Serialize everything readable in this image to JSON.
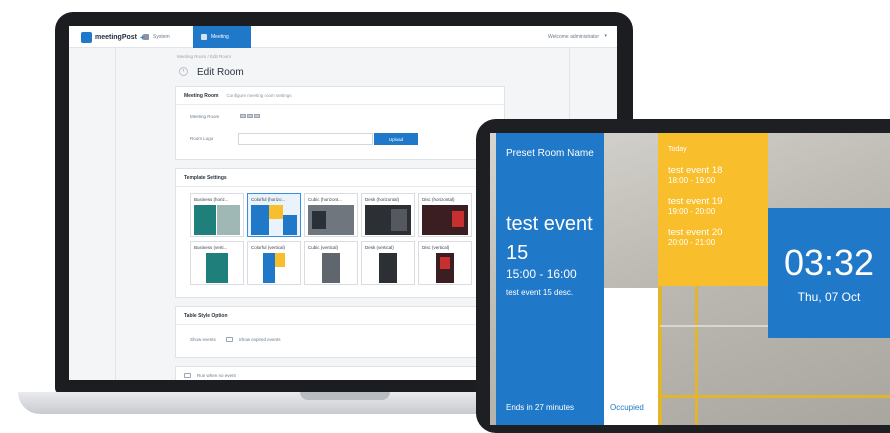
{
  "admin": {
    "app_name": "meetingPost",
    "app_plus": "+",
    "nav": [
      {
        "label": "System"
      },
      {
        "label": "Meeting"
      }
    ],
    "welcome": "Welcome administrator",
    "breadcrumb": "Meeting Room / Edit Room",
    "page_title": "Edit Room",
    "meeting_room_card": {
      "title": "Meeting Room",
      "subtitle": "Configure meeting room settings",
      "meeting_room_label": "Meeting Room",
      "room_logo_label": "Room Logo",
      "upload_label": "Upload"
    },
    "template_card": {
      "title": "Template Settings",
      "templates": [
        {
          "label": "Business (horiz..."
        },
        {
          "label": "Colorful (horizo..."
        },
        {
          "label": "Cubic (horizont..."
        },
        {
          "label": "Desk (horizontal)"
        },
        {
          "label": "Disc (horizontal)"
        },
        {
          "label": "Business (verti..."
        },
        {
          "label": "Colorful (vertical)"
        },
        {
          "label": "Cubic (vertical)"
        },
        {
          "label": "Desk (vertical)"
        },
        {
          "label": "Disc (vertical)"
        }
      ]
    },
    "table_card": {
      "title": "Table Style Option",
      "show_events_label": "Show events",
      "show_expired_label": "Show expired events"
    },
    "bottom_option": "Run when no event"
  },
  "display": {
    "room_name": "Preset Room Name",
    "current_event": "test event 15",
    "current_time": "15:00 - 16:00",
    "current_desc": "test event 15 desc.",
    "ends_in": "Ends in 27 minutes",
    "status": "Occupied",
    "today_label": "Today",
    "upcoming": [
      {
        "name": "test event 18",
        "time": "18:00 - 19:00"
      },
      {
        "name": "test event 19",
        "time": "19:00 - 20:00"
      },
      {
        "name": "test event 20",
        "time": "20:00 - 21:00"
      }
    ],
    "clock": "03:32",
    "date": "Thu, 07 Oct"
  },
  "colors": {
    "brand_blue": "#1f78c8",
    "accent_yellow": "#f8be2c",
    "bezel": "#1b1d20"
  }
}
